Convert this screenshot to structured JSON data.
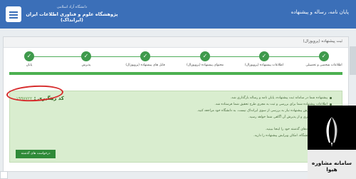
{
  "header": {
    "brand_line1": "دانشگاه آزاد اسلامی",
    "brand_line2": "پژوهشگاه علوم و فناوری اطلاعات ایران (ایرانداک)",
    "page_title": "پایان نامه، رساله و پیشنهاده"
  },
  "panel": {
    "heading": "ثبت پیشنهاده (پروپوزال)"
  },
  "wizard": {
    "steps": [
      {
        "label": "اطلاعات شخصی و تحصیلی"
      },
      {
        "label": "اطلاعات پیشنهاده (پروپوزال)"
      },
      {
        "label": "محتوای پیشنهاده (پروپوزال)"
      },
      {
        "label": "فایل های پیشنهاده (پروپوزال)"
      },
      {
        "label": "پذیرش"
      },
      {
        "label": "پایان"
      }
    ]
  },
  "result": {
    "code_label": "کد رهگیری :",
    "code_value": "۱۹۹۷۷۲۲",
    "messages": [
      "پیشنهاده شما در سامانه ثبت پیشنهاده، پایان نامه و رساله بارگذاری شد.",
      "اطلاعات پیشنهاده شما برای بررسی و ثبت به مجری طرح تحقیق شما فرستاده شد.",
      "از استفاده پذیرش پیشنهاده نیاز به بررسی از سوی ایرانداک نیست. به دانشگاه خود مراجعه کنید.",
      "دانشگاه را پیگیری و از پذیرش آن آگاهی شما خواهد رسید.",
      "فهرست پیشنهادهای گذشته خود را اینجا ببینید.",
      "تا زمان تایید دانشگاه، امکان ویرایش پیشنهاده را دارید."
    ],
    "back_button": "درخواست های گذشته"
  },
  "watermark": {
    "text": "سامانه مشاوره هیوا"
  },
  "colors": {
    "header_blue": "#3b6fb8",
    "success_green": "#4cb050",
    "highlight_red": "#d62b2b"
  }
}
